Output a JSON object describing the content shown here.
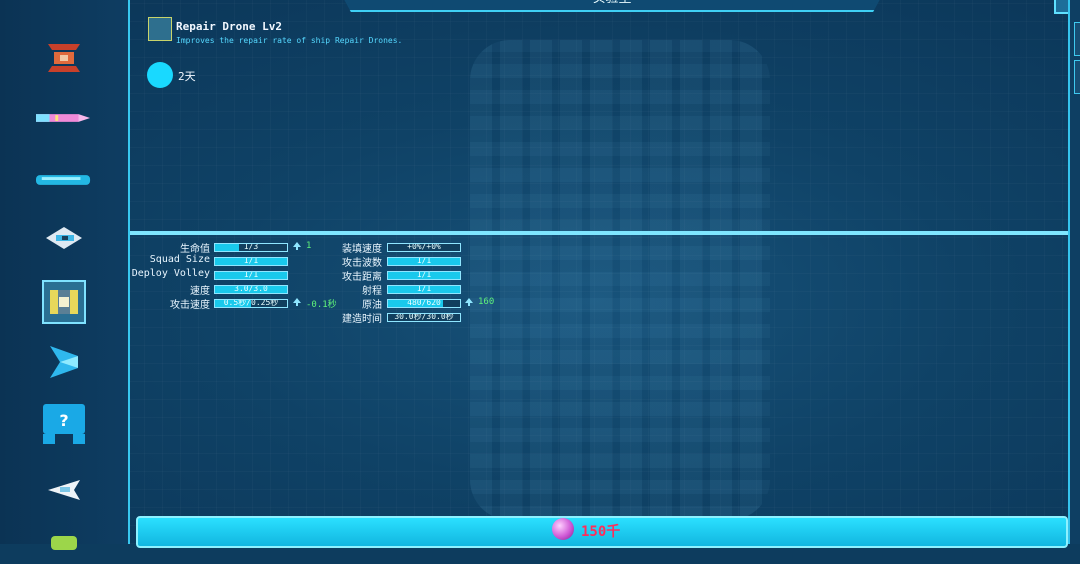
{
  "window": {
    "title": "实验室"
  },
  "sidebar": {
    "items": [
      {
        "icon": "red-ship-icon",
        "selected": false
      },
      {
        "icon": "missile-icon",
        "selected": false
      },
      {
        "icon": "cannon-icon",
        "selected": false
      },
      {
        "icon": "fighter-icon",
        "selected": false
      },
      {
        "icon": "repair-drone-icon",
        "selected": true
      },
      {
        "icon": "blue-cruiser-icon",
        "selected": false
      },
      {
        "icon": "unknown-question-icon",
        "selected": false
      },
      {
        "icon": "white-jet-icon",
        "selected": false
      },
      {
        "icon": "green-unit-icon",
        "selected": false
      }
    ]
  },
  "research": {
    "title": "Repair Drone Lv2",
    "description": "Improves the repair rate of ship Repair Drones.",
    "time": "2天"
  },
  "stats": {
    "left": [
      {
        "label": "生命值",
        "value": "1/3",
        "fill": 0.33,
        "delta": "1"
      },
      {
        "label": "Squad Size",
        "value": "1/1",
        "fill": 1.0,
        "delta": ""
      },
      {
        "label": "Deploy Volley",
        "value": "1/1",
        "fill": 1.0,
        "delta": ""
      },
      {
        "label": "速度",
        "value": "3.0/3.0",
        "fill": 1.0,
        "delta": ""
      },
      {
        "label": "攻击速度",
        "value": "0.5秒/0.25秒",
        "fill": 0.5,
        "delta": "-0.1秒"
      }
    ],
    "right": [
      {
        "label": "装填速度",
        "value": "+0%/+0%",
        "fill": 0.0,
        "delta": ""
      },
      {
        "label": "攻击波数",
        "value": "1/1",
        "fill": 1.0,
        "delta": ""
      },
      {
        "label": "攻击距离",
        "value": "1/1",
        "fill": 1.0,
        "delta": ""
      },
      {
        "label": "射程",
        "value": "1/1",
        "fill": 1.0,
        "delta": ""
      },
      {
        "label": "原油",
        "value": "480/620",
        "fill": 0.77,
        "delta": "160"
      },
      {
        "label": "建造时间",
        "value": "30.0秒/30.0秒",
        "fill": 0.0,
        "delta": ""
      }
    ]
  },
  "footer": {
    "cost": "150千"
  },
  "colors": {
    "accent": "#19d9ff",
    "delta_green": "#5ff27a",
    "cost_red": "#ff2d5a"
  }
}
